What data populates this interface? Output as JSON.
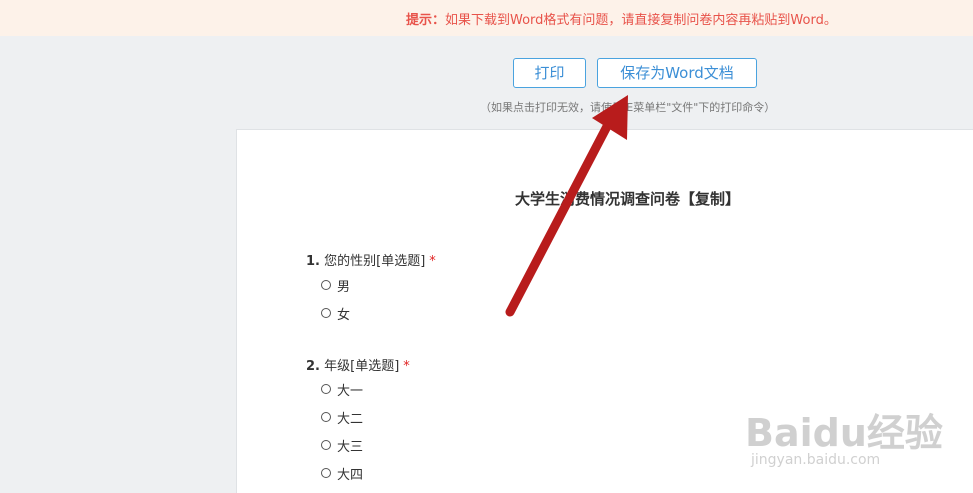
{
  "tip_bar": {
    "label": "提示：",
    "message": "如果下载到Word格式有问题，请直接复制问卷内容再粘贴到Word。"
  },
  "toolbar": {
    "print_label": "打印",
    "save_word_label": "保存为Word文档",
    "print_hint": "（如果点击打印无效，请使用IE菜单栏\"文件\"下的打印命令）"
  },
  "survey": {
    "title": "大学生消费情况调查问卷【复制】",
    "questions": [
      {
        "number": "1.",
        "text": "您的性别[单选题]",
        "required_mark": "*",
        "options": [
          "男",
          "女"
        ]
      },
      {
        "number": "2.",
        "text": "年级[单选题]",
        "required_mark": "*",
        "options": [
          "大一",
          "大二",
          "大三",
          "大四"
        ]
      }
    ]
  },
  "watermark": {
    "logo": "Baidu经验",
    "url": "jingyan.baidu.com"
  },
  "colors": {
    "tip_text": "#e8534a",
    "button_border": "#4aa3df",
    "arrow": "#b81c1c",
    "required": "#e02020"
  }
}
